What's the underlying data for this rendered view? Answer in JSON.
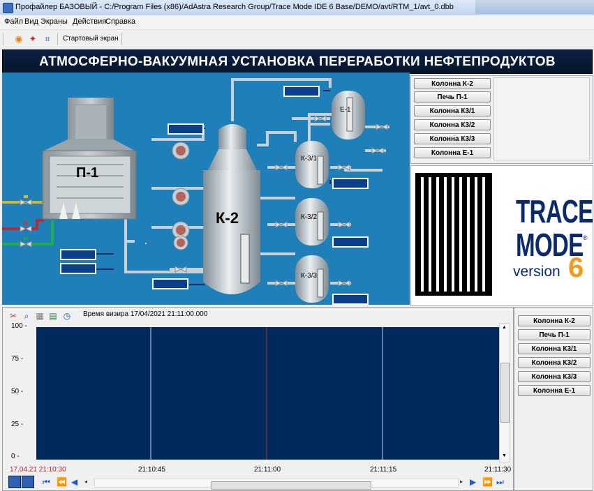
{
  "window": {
    "title": "Профайлер БАЗОВЫЙ - C:/Program Files (x86)/AdAstra Research Group/Trace Mode IDE 6 Base/DEMO/avt/RTM_1/avt_0.dbb"
  },
  "menu": {
    "items": [
      "Файл",
      "Вид",
      "Экраны",
      "Действия",
      "Справка"
    ]
  },
  "toolbar": {
    "start_screen_label": "Стартовый экран",
    "icons": [
      "screen-icon",
      "runner-icon",
      "fit-frame-icon"
    ]
  },
  "banner": {
    "title": "АТМОСФЕРНО-ВАКУУМНАЯ УСТАНОВКА ПЕРЕРАБОТКИ НЕФТЕПРОДУКТОВ"
  },
  "process": {
    "furnace_label": "П-1",
    "column_label": "К-2",
    "e1_label": "Е-1",
    "k31_label": "К-3/1",
    "k32_label": "К-3/2",
    "k33_label": "К-3/3",
    "colors": {
      "background": "#1f7fb8",
      "vessel": "#b9c4cc",
      "pipe": "#c8d0d6",
      "value_box": "#0a3f8c"
    }
  },
  "nav_top": {
    "buttons": [
      "Колонна К-2",
      "Печь П-1",
      "Колонна К3/1",
      "Колонна К3/2",
      "Колонна К3/3",
      "Колонна Е-1"
    ]
  },
  "logo": {
    "line1": "TRACE",
    "line2": "MODE",
    "registered": "®",
    "version": "version",
    "version_number": "6"
  },
  "trend": {
    "vizir_label": "Время визира 17/04/2021 21:11:00.000",
    "y_ticks": [
      "100 -",
      "75 -",
      "50 -",
      "25 -",
      "0 -"
    ],
    "x_ticks": [
      "17.04.21 21:10:30",
      "21:10:45",
      "21:11:00",
      "21:11:15",
      "21:11:30"
    ],
    "colors": {
      "plot_bg": "#002a5c",
      "grid": "#c9d3e0",
      "cursor": "#c2262e",
      "start_label": "#b22222"
    }
  },
  "nav_trend": {
    "buttons": [
      "Колонна К-2",
      "Печь П-1",
      "Колонна К3/1",
      "Колонна К3/2",
      "Колонна К3/3",
      "Колонна Е-1"
    ]
  }
}
